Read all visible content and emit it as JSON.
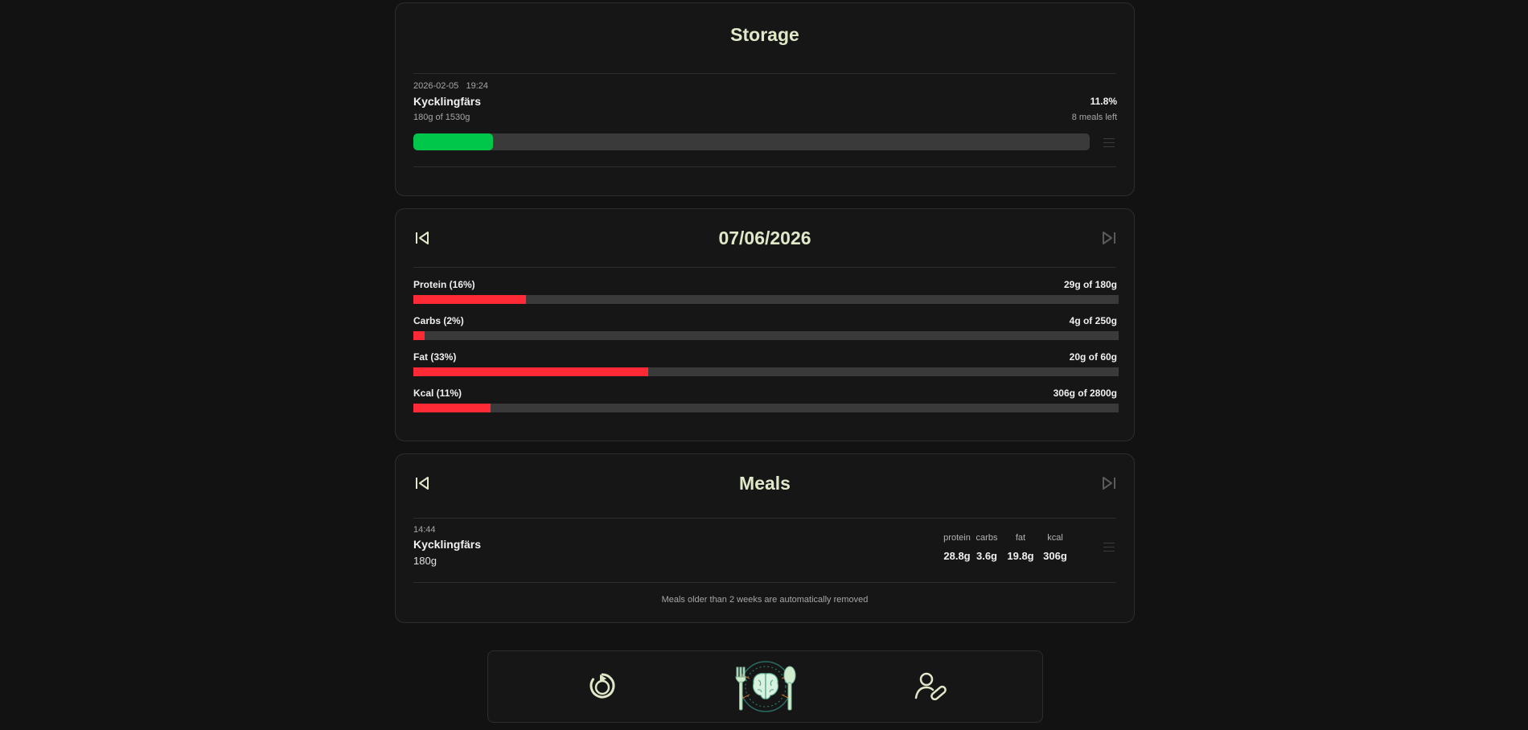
{
  "storage": {
    "title": "Storage",
    "item": {
      "date": "2026-02-05",
      "time": "19:24",
      "name": "Kycklingfärs",
      "amount_text": "180g of 1530g",
      "percent_text": "11.8%",
      "meals_left": "8 meals left",
      "progress": 0.118,
      "bar_color": "#00c74a"
    }
  },
  "daily": {
    "date": "07/06/2026",
    "macros": [
      {
        "label": "Protein (16%)",
        "value": "29g of 180g",
        "progress": 0.16
      },
      {
        "label": "Carbs (2%)",
        "value": "4g of 250g",
        "progress": 0.016
      },
      {
        "label": "Fat (33%)",
        "value": "20g of 60g",
        "progress": 0.333
      },
      {
        "label": "Kcal (11%)",
        "value": "306g of 2800g",
        "progress": 0.109
      }
    ],
    "bar_color": "#ff2a35"
  },
  "meals": {
    "title": "Meals",
    "items": [
      {
        "time": "14:44",
        "name": "Kycklingfärs",
        "amount": "180g",
        "nutrients": [
          {
            "key": "protein",
            "value": "28.8g"
          },
          {
            "key": "carbs",
            "value": "3.6g"
          },
          {
            "key": "fat",
            "value": "19.8g"
          },
          {
            "key": "kcal",
            "value": "306g"
          }
        ]
      }
    ],
    "footer_note": "Meals older than 2 weeks are automatically removed"
  },
  "bottom_nav": {
    "items": [
      {
        "icon": "progress-play-icon"
      },
      {
        "icon": "app-logo-icon"
      },
      {
        "icon": "user-edit-icon"
      }
    ]
  },
  "colors": {
    "accent_title": "#dfe8c8",
    "storage_bar": "#00c74a",
    "macro_bar": "#ff2a35"
  }
}
